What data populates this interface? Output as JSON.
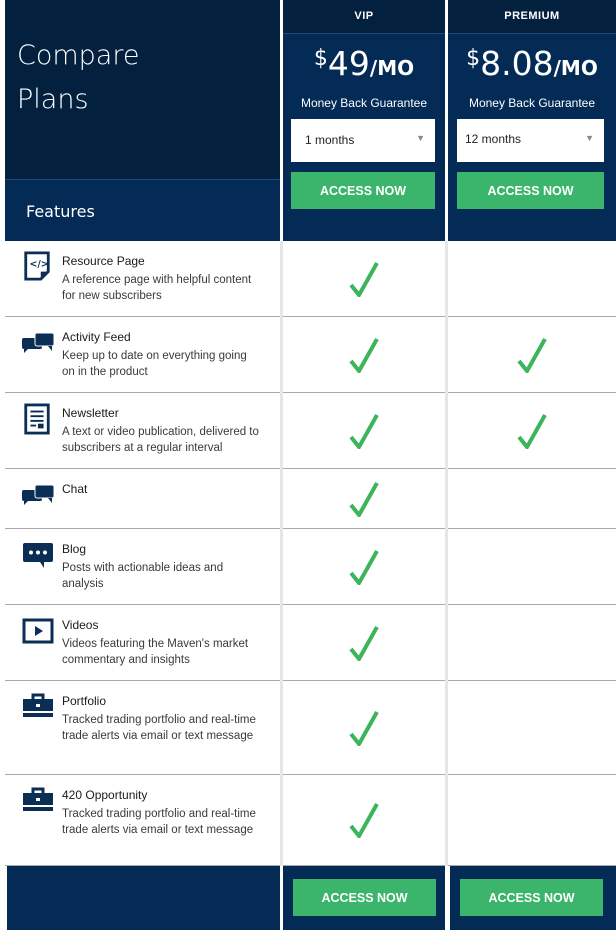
{
  "header": {
    "title_line1": "Compare",
    "title_line2": "Plans",
    "features_label": "Features"
  },
  "plans": [
    {
      "name": "VIP",
      "currency": "$",
      "amount": "49",
      "period": "/MO",
      "guarantee": "Money Back Guarantee",
      "duration": "1 months",
      "cta": "ACCESS NOW"
    },
    {
      "name": "PREMIUM",
      "currency": "$",
      "amount": "8.08",
      "period": "/MO",
      "guarantee": "Money Back Guarantee",
      "duration": "12 months",
      "cta": "ACCESS NOW"
    }
  ],
  "features": [
    {
      "name": "Resource Page",
      "desc": "A reference page with helpful content for new subscribers",
      "icon": "code-document-icon",
      "vip": true,
      "premium": false
    },
    {
      "name": "Activity Feed",
      "desc": "Keep up to date on everything going on in the product",
      "icon": "chat-bubbles-icon",
      "vip": true,
      "premium": true
    },
    {
      "name": "Newsletter",
      "desc": "A text or video publication, delivered to subscribers at a regular interval",
      "icon": "newsletter-icon",
      "vip": true,
      "premium": true
    },
    {
      "name": "Chat",
      "desc": "",
      "icon": "chat-bubbles-icon",
      "vip": true,
      "premium": false
    },
    {
      "name": "Blog",
      "desc": "Posts with actionable ideas and analysis",
      "icon": "speech-dots-icon",
      "vip": true,
      "premium": false
    },
    {
      "name": "Videos",
      "desc": "Videos featuring the Maven's market commentary and insights",
      "icon": "video-play-icon",
      "vip": true,
      "premium": false
    },
    {
      "name": "Portfolio",
      "desc": "Tracked trading portfolio and real-time trade alerts via email or text message",
      "icon": "briefcase-icon",
      "vip": true,
      "premium": false
    },
    {
      "name": "420 Opportunity",
      "desc": "Tracked trading portfolio and real-time trade alerts via email or text message",
      "icon": "briefcase-icon",
      "vip": true,
      "premium": false
    }
  ],
  "footer": {
    "vip_cta": "ACCESS NOW",
    "premium_cta": "ACCESS NOW"
  },
  "colors": {
    "navy": "#032b55",
    "navy_dark": "#03213f",
    "green": "#3bb56b",
    "check": "#3cb55a"
  }
}
